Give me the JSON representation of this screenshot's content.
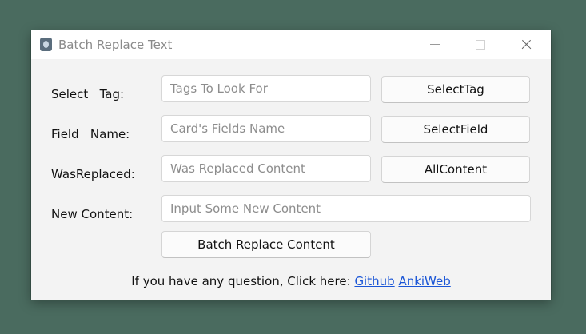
{
  "window": {
    "title": "Batch Replace Text",
    "controls": {
      "minimize": "minimize",
      "maximize": "maximize",
      "close": "close"
    }
  },
  "form": {
    "select_tag_label": "Select   Tag:",
    "field_name_label": "Field   Name:",
    "was_replaced_label": "WasReplaced:",
    "new_content_label": "New Content:",
    "tags_placeholder": "Tags To Look For",
    "fields_placeholder": "Card's Fields Name",
    "was_replaced_placeholder": "Was Replaced Content",
    "new_content_placeholder": "Input Some New Content",
    "select_tag_button": "SelectTag",
    "select_field_button": "SelectField",
    "all_content_button": "AllContent",
    "batch_replace_button": "Batch Replace Content"
  },
  "footer": {
    "text": "If you have any question, Click here: ",
    "github_link": "Github",
    "ankiweb_link": "AnkiWeb",
    "link_color": "#1a55d6"
  },
  "colors": {
    "desktop_background": "#4a6b5f",
    "window_background": "#f3f3f3",
    "titlebar_background": "#ffffff"
  }
}
